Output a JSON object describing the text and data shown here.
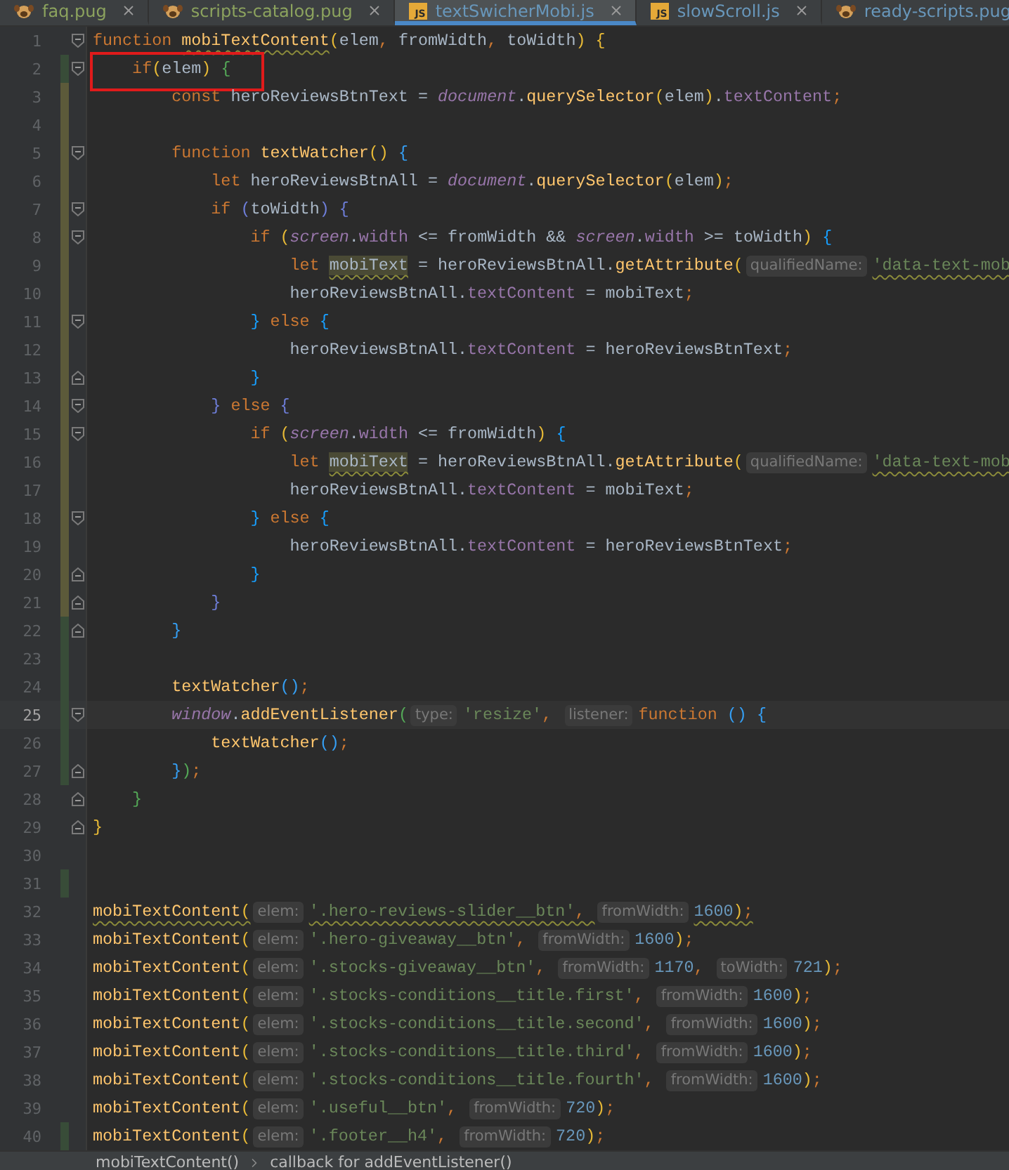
{
  "tabs": [
    {
      "label": "faq.pug",
      "kind": "pug",
      "color": "#8ca35e",
      "selected": false
    },
    {
      "label": "scripts-catalog.pug",
      "kind": "pug",
      "color": "#8ca35e",
      "selected": false
    },
    {
      "label": "textSwicherMobi.js",
      "kind": "js",
      "badge": "JS",
      "color": "#6897bb",
      "selected": true
    },
    {
      "label": "slowScroll.js",
      "kind": "js",
      "badge": "JS",
      "color": "#6897bb",
      "selected": false
    },
    {
      "label": "ready-scripts.pug",
      "kind": "pug",
      "color": "#6897bb",
      "selected": false
    }
  ],
  "lines": [
    {
      "number": "1",
      "kind": "fold-start",
      "current": false,
      "annotated": false,
      "tokens": [
        {
          "kind": "kw",
          "t": "function "
        },
        {
          "kind": "fn-warn",
          "t": "mobiTextContent"
        },
        {
          "kind": "brace",
          "t": "(",
          "color": "#e8ba36"
        },
        {
          "kind": "id",
          "t": "elem"
        },
        {
          "kind": "punct",
          "t": ", "
        },
        {
          "kind": "id",
          "t": "fromWidth"
        },
        {
          "kind": "punct",
          "t": ", "
        },
        {
          "kind": "id",
          "t": "toWidth"
        },
        {
          "kind": "brace",
          "t": ") ",
          "color": "#e8ba36"
        },
        {
          "kind": "brace",
          "t": "{",
          "color": "#e8ba36"
        }
      ]
    },
    {
      "number": "2",
      "kind": "fold-start",
      "color": "#384c38",
      "current": false,
      "annotated": true,
      "tokens": [
        {
          "kind": "kw",
          "t": "    if"
        },
        {
          "kind": "brace",
          "t": "(",
          "color": "#e8ba36"
        },
        {
          "kind": "id",
          "t": "elem"
        },
        {
          "kind": "brace",
          "t": ") ",
          "color": "#e8ba36"
        },
        {
          "kind": "brace",
          "t": "{",
          "color": "#54a857"
        }
      ]
    },
    {
      "number": "3",
      "kind": "plain",
      "color": "#5c5a3a",
      "current": false,
      "annotated": false,
      "tokens": [
        {
          "kind": "kw",
          "t": "        const "
        },
        {
          "kind": "id",
          "t": "heroReviewsBtnText = "
        },
        {
          "kind": "glob",
          "t": "document"
        },
        {
          "kind": "id",
          "t": "."
        },
        {
          "kind": "fn",
          "t": "querySelector"
        },
        {
          "kind": "brace",
          "t": "(",
          "color": "#e8ba36"
        },
        {
          "kind": "id",
          "t": "elem"
        },
        {
          "kind": "brace",
          "t": ")",
          "color": "#e8ba36"
        },
        {
          "kind": "id",
          "t": "."
        },
        {
          "kind": "prop",
          "t": "textContent"
        },
        {
          "kind": "punct",
          "t": ";"
        }
      ]
    },
    {
      "number": "4",
      "kind": "plain",
      "color": "#5c5a3a",
      "current": false,
      "annotated": false
    },
    {
      "number": "5",
      "kind": "fold-start",
      "color": "#5c5a3a",
      "current": false,
      "annotated": false,
      "tokens": [
        {
          "kind": "kw",
          "t": "        function "
        },
        {
          "kind": "fn",
          "t": "textWatcher"
        },
        {
          "kind": "brace",
          "t": "() ",
          "color": "#e8ba36"
        },
        {
          "kind": "brace",
          "t": "{",
          "color": "#359ff4"
        }
      ]
    },
    {
      "number": "6",
      "kind": "plain",
      "color": "#5c5a3a",
      "current": false,
      "annotated": false,
      "tokens": [
        {
          "kind": "kw",
          "t": "            let "
        },
        {
          "kind": "id",
          "t": "heroReviewsBtnAll = "
        },
        {
          "kind": "glob",
          "t": "document"
        },
        {
          "kind": "id",
          "t": "."
        },
        {
          "kind": "fn",
          "t": "querySelector"
        },
        {
          "kind": "brace",
          "t": "(",
          "color": "#e8ba36"
        },
        {
          "kind": "id",
          "t": "elem"
        },
        {
          "kind": "brace",
          "t": ")",
          "color": "#e8ba36"
        },
        {
          "kind": "punct",
          "t": ";"
        }
      ]
    },
    {
      "number": "7",
      "kind": "fold-start",
      "color": "#5c5a3a",
      "current": false,
      "annotated": false,
      "tokens": [
        {
          "kind": "kw",
          "t": "            if "
        },
        {
          "kind": "brace",
          "t": "(",
          "color": "#6e7ed9"
        },
        {
          "kind": "id",
          "t": "toWidth"
        },
        {
          "kind": "brace",
          "t": ") ",
          "color": "#6e7ed9"
        },
        {
          "kind": "brace",
          "t": "{",
          "color": "#6e7ed9"
        }
      ]
    },
    {
      "number": "8",
      "kind": "fold-start",
      "color": "#5c5a3a",
      "current": false,
      "annotated": false,
      "tokens": [
        {
          "kind": "kw",
          "t": "                if "
        },
        {
          "kind": "brace",
          "t": "(",
          "color": "#e8ba36"
        },
        {
          "kind": "glob",
          "t": "screen"
        },
        {
          "kind": "id",
          "t": "."
        },
        {
          "kind": "prop",
          "t": "width"
        },
        {
          "kind": "id",
          "t": " <= fromWidth && "
        },
        {
          "kind": "glob",
          "t": "screen"
        },
        {
          "kind": "id",
          "t": "."
        },
        {
          "kind": "prop",
          "t": "width"
        },
        {
          "kind": "id",
          "t": " >= toWidth"
        },
        {
          "kind": "brace",
          "t": ") ",
          "color": "#e8ba36"
        },
        {
          "kind": "brace",
          "t": "{",
          "color": "#179fff"
        }
      ]
    },
    {
      "number": "9",
      "kind": "plain",
      "color": "#5c5a3a",
      "current": false,
      "annotated": false,
      "tokens": [
        {
          "kind": "kw",
          "t": "                    let "
        },
        {
          "kind": "usage",
          "t": "mobiText"
        },
        {
          "kind": "id",
          "t": " = heroReviewsBtnAll."
        },
        {
          "kind": "fn",
          "t": "getAttribute"
        },
        {
          "kind": "brace",
          "t": "(",
          "color": "#e8ba36"
        },
        {
          "kind": "hint",
          "t": "qualifiedName:"
        },
        {
          "kind": "str-warn",
          "t": "'data-text-mob"
        }
      ]
    },
    {
      "number": "10",
      "kind": "plain",
      "color": "#5c5a3a",
      "current": false,
      "annotated": false,
      "tokens": [
        {
          "kind": "id",
          "t": "                    heroReviewsBtnAll."
        },
        {
          "kind": "prop",
          "t": "textContent"
        },
        {
          "kind": "id",
          "t": " = mobiText"
        },
        {
          "kind": "punct",
          "t": ";"
        }
      ]
    },
    {
      "number": "11",
      "kind": "fold-start",
      "color": "#5c5a3a",
      "current": false,
      "annotated": false,
      "tokens": [
        {
          "kind": "brace",
          "t": "                }",
          "color": "#179fff"
        },
        {
          "kind": "kw",
          "t": " else "
        },
        {
          "kind": "brace",
          "t": "{",
          "color": "#179fff"
        }
      ]
    },
    {
      "number": "12",
      "kind": "plain",
      "color": "#5c5a3a",
      "current": false,
      "annotated": false,
      "tokens": [
        {
          "kind": "id",
          "t": "                    heroReviewsBtnAll."
        },
        {
          "kind": "prop",
          "t": "textContent"
        },
        {
          "kind": "id",
          "t": " = heroReviewsBtnText"
        },
        {
          "kind": "punct",
          "t": ";"
        }
      ]
    },
    {
      "number": "13",
      "kind": "fold-end",
      "color": "#5c5a3a",
      "current": false,
      "annotated": false,
      "tokens": [
        {
          "kind": "brace",
          "t": "                }",
          "color": "#179fff"
        }
      ]
    },
    {
      "number": "14",
      "kind": "fold-start",
      "color": "#5c5a3a",
      "current": false,
      "annotated": false,
      "tokens": [
        {
          "kind": "brace",
          "t": "            }",
          "color": "#6e7ed9"
        },
        {
          "kind": "kw",
          "t": " else "
        },
        {
          "kind": "brace",
          "t": "{",
          "color": "#6e7ed9"
        }
      ]
    },
    {
      "number": "15",
      "kind": "fold-start",
      "color": "#5c5a3a",
      "current": false,
      "annotated": false,
      "tokens": [
        {
          "kind": "kw",
          "t": "                if "
        },
        {
          "kind": "brace",
          "t": "(",
          "color": "#e8ba36"
        },
        {
          "kind": "glob",
          "t": "screen"
        },
        {
          "kind": "id",
          "t": "."
        },
        {
          "kind": "prop",
          "t": "width"
        },
        {
          "kind": "id",
          "t": " <= fromWidth"
        },
        {
          "kind": "brace",
          "t": ") ",
          "color": "#e8ba36"
        },
        {
          "kind": "brace",
          "t": "{",
          "color": "#179fff"
        }
      ]
    },
    {
      "number": "16",
      "kind": "plain",
      "color": "#5c5a3a",
      "current": false,
      "annotated": false,
      "tokens": [
        {
          "kind": "kw",
          "t": "                    let "
        },
        {
          "kind": "usage",
          "t": "mobiText"
        },
        {
          "kind": "id",
          "t": " = heroReviewsBtnAll."
        },
        {
          "kind": "fn",
          "t": "getAttribute"
        },
        {
          "kind": "brace",
          "t": "(",
          "color": "#e8ba36"
        },
        {
          "kind": "hint",
          "t": "qualifiedName:"
        },
        {
          "kind": "str-warn",
          "t": "'data-text-mob"
        }
      ]
    },
    {
      "number": "17",
      "kind": "plain",
      "color": "#5c5a3a",
      "current": false,
      "annotated": false,
      "tokens": [
        {
          "kind": "id",
          "t": "                    heroReviewsBtnAll."
        },
        {
          "kind": "prop",
          "t": "textContent"
        },
        {
          "kind": "id",
          "t": " = mobiText"
        },
        {
          "kind": "punct",
          "t": ";"
        }
      ]
    },
    {
      "number": "18",
      "kind": "fold-start",
      "color": "#5c5a3a",
      "current": false,
      "annotated": false,
      "tokens": [
        {
          "kind": "brace",
          "t": "                }",
          "color": "#179fff"
        },
        {
          "kind": "kw",
          "t": " else "
        },
        {
          "kind": "brace",
          "t": "{",
          "color": "#179fff"
        }
      ]
    },
    {
      "number": "19",
      "kind": "plain",
      "color": "#5c5a3a",
      "current": false,
      "annotated": false,
      "tokens": [
        {
          "kind": "id",
          "t": "                    heroReviewsBtnAll."
        },
        {
          "kind": "prop",
          "t": "textContent"
        },
        {
          "kind": "id",
          "t": " = heroReviewsBtnText"
        },
        {
          "kind": "punct",
          "t": ";"
        }
      ]
    },
    {
      "number": "20",
      "kind": "fold-end",
      "color": "#5c5a3a",
      "current": false,
      "annotated": false,
      "tokens": [
        {
          "kind": "brace",
          "t": "                }",
          "color": "#179fff"
        }
      ]
    },
    {
      "number": "21",
      "kind": "fold-end",
      "color": "#5c5a3a",
      "current": false,
      "annotated": false,
      "tokens": [
        {
          "kind": "brace",
          "t": "            }",
          "color": "#6e7ed9"
        }
      ]
    },
    {
      "number": "22",
      "kind": "fold-end",
      "color": "#384c38",
      "current": false,
      "annotated": false,
      "tokens": [
        {
          "kind": "brace",
          "t": "        }",
          "color": "#359ff4"
        }
      ]
    },
    {
      "number": "23",
      "kind": "plain",
      "color": "#384c38",
      "current": false,
      "annotated": false
    },
    {
      "number": "24",
      "kind": "plain",
      "color": "#384c38",
      "current": false,
      "annotated": false,
      "tokens": [
        {
          "kind": "fn",
          "t": "        textWatcher"
        },
        {
          "kind": "brace",
          "t": "()",
          "color": "#359ff4"
        },
        {
          "kind": "punct",
          "t": ";"
        }
      ]
    },
    {
      "number": "25",
      "kind": "fold-start",
      "color": "#384c38",
      "current": true,
      "annotated": false,
      "tokens": [
        {
          "kind": "glob",
          "t": "        window"
        },
        {
          "kind": "id",
          "t": "."
        },
        {
          "kind": "fn",
          "t": "addEventListener"
        },
        {
          "kind": "brace",
          "t": "(",
          "color": "#54a857"
        },
        {
          "kind": "hint",
          "t": "type:"
        },
        {
          "kind": "str",
          "t": "'resize'"
        },
        {
          "kind": "punct",
          "t": ", "
        },
        {
          "kind": "hint",
          "t": "listener:"
        },
        {
          "kind": "kw",
          "t": "function "
        },
        {
          "kind": "brace",
          "t": "() ",
          "color": "#359ff4"
        },
        {
          "kind": "brace",
          "t": "{",
          "color": "#359ff4"
        }
      ]
    },
    {
      "number": "26",
      "kind": "plain",
      "color": "#384c38",
      "current": false,
      "annotated": false,
      "tokens": [
        {
          "kind": "fn",
          "t": "            textWatcher"
        },
        {
          "kind": "brace",
          "t": "()",
          "color": "#359ff4"
        },
        {
          "kind": "punct",
          "t": ";"
        }
      ]
    },
    {
      "number": "27",
      "kind": "fold-end",
      "color": "#384c38",
      "current": false,
      "annotated": false,
      "tokens": [
        {
          "kind": "brace",
          "t": "        }",
          "color": "#359ff4"
        },
        {
          "kind": "brace",
          "t": ")",
          "color": "#54a857"
        },
        {
          "kind": "punct",
          "t": ";"
        }
      ]
    },
    {
      "number": "28",
      "kind": "fold-end",
      "current": false,
      "annotated": false,
      "tokens": [
        {
          "kind": "brace",
          "t": "    }",
          "color": "#54a857"
        }
      ]
    },
    {
      "number": "29",
      "kind": "fold-end",
      "current": false,
      "annotated": false,
      "tokens": [
        {
          "kind": "brace",
          "t": "}",
          "color": "#e8ba36"
        }
      ]
    },
    {
      "number": "30",
      "kind": "plain",
      "current": false,
      "annotated": false
    },
    {
      "number": "31",
      "kind": "plain",
      "color": "#384c38",
      "current": false,
      "annotated": false
    },
    {
      "number": "32",
      "kind": "plain",
      "current": false,
      "annotated": false,
      "tokens": [
        {
          "kind": "fn-warn",
          "t": "mobiTextContent"
        },
        {
          "kind": "brace-warn",
          "t": "(",
          "color": "#e8ba36"
        },
        {
          "kind": "hint",
          "t": "elem:"
        },
        {
          "kind": "str-warn",
          "t": "'.hero-reviews-slider__btn'"
        },
        {
          "kind": "punct-warn",
          "t": ", "
        },
        {
          "kind": "hint",
          "t": "fromWidth:"
        },
        {
          "kind": "num-warn",
          "t": "1600"
        },
        {
          "kind": "brace-warn",
          "t": ")",
          "color": "#e8ba36"
        },
        {
          "kind": "punct-warn",
          "t": ";"
        }
      ]
    },
    {
      "number": "33",
      "kind": "plain",
      "current": false,
      "annotated": false,
      "tokens": [
        {
          "kind": "fn",
          "t": "mobiTextContent"
        },
        {
          "kind": "brace",
          "t": "(",
          "color": "#e8ba36"
        },
        {
          "kind": "hint",
          "t": "elem:"
        },
        {
          "kind": "str",
          "t": "'.hero-giveaway__btn'"
        },
        {
          "kind": "punct",
          "t": ", "
        },
        {
          "kind": "hint",
          "t": "fromWidth:"
        },
        {
          "kind": "num",
          "t": "1600"
        },
        {
          "kind": "brace",
          "t": ")",
          "color": "#e8ba36"
        },
        {
          "kind": "punct",
          "t": ";"
        }
      ]
    },
    {
      "number": "34",
      "kind": "plain",
      "current": false,
      "annotated": false,
      "tokens": [
        {
          "kind": "fn",
          "t": "mobiTextContent"
        },
        {
          "kind": "brace",
          "t": "(",
          "color": "#e8ba36"
        },
        {
          "kind": "hint",
          "t": "elem:"
        },
        {
          "kind": "str",
          "t": "'.stocks-giveaway__btn'"
        },
        {
          "kind": "punct",
          "t": ", "
        },
        {
          "kind": "hint",
          "t": "fromWidth:"
        },
        {
          "kind": "num",
          "t": "1170"
        },
        {
          "kind": "punct",
          "t": ", "
        },
        {
          "kind": "hint",
          "t": "toWidth:"
        },
        {
          "kind": "num",
          "t": "721"
        },
        {
          "kind": "brace",
          "t": ")",
          "color": "#e8ba36"
        },
        {
          "kind": "punct",
          "t": ";"
        }
      ]
    },
    {
      "number": "35",
      "kind": "plain",
      "current": false,
      "annotated": false,
      "tokens": [
        {
          "kind": "fn",
          "t": "mobiTextContent"
        },
        {
          "kind": "brace",
          "t": "(",
          "color": "#e8ba36"
        },
        {
          "kind": "hint",
          "t": "elem:"
        },
        {
          "kind": "str",
          "t": "'.stocks-conditions__title.first'"
        },
        {
          "kind": "punct",
          "t": ", "
        },
        {
          "kind": "hint",
          "t": "fromWidth:"
        },
        {
          "kind": "num",
          "t": "1600"
        },
        {
          "kind": "brace",
          "t": ")",
          "color": "#e8ba36"
        },
        {
          "kind": "punct",
          "t": ";"
        }
      ]
    },
    {
      "number": "36",
      "kind": "plain",
      "current": false,
      "annotated": false,
      "tokens": [
        {
          "kind": "fn",
          "t": "mobiTextContent"
        },
        {
          "kind": "brace",
          "t": "(",
          "color": "#e8ba36"
        },
        {
          "kind": "hint",
          "t": "elem:"
        },
        {
          "kind": "str",
          "t": "'.stocks-conditions__title.second'"
        },
        {
          "kind": "punct",
          "t": ", "
        },
        {
          "kind": "hint",
          "t": "fromWidth:"
        },
        {
          "kind": "num",
          "t": "1600"
        },
        {
          "kind": "brace",
          "t": ")",
          "color": "#e8ba36"
        },
        {
          "kind": "punct",
          "t": ";"
        }
      ]
    },
    {
      "number": "37",
      "kind": "plain",
      "current": false,
      "annotated": false,
      "tokens": [
        {
          "kind": "fn",
          "t": "mobiTextContent"
        },
        {
          "kind": "brace",
          "t": "(",
          "color": "#e8ba36"
        },
        {
          "kind": "hint",
          "t": "elem:"
        },
        {
          "kind": "str",
          "t": "'.stocks-conditions__title.third'"
        },
        {
          "kind": "punct",
          "t": ", "
        },
        {
          "kind": "hint",
          "t": "fromWidth:"
        },
        {
          "kind": "num",
          "t": "1600"
        },
        {
          "kind": "brace",
          "t": ")",
          "color": "#e8ba36"
        },
        {
          "kind": "punct",
          "t": ";"
        }
      ]
    },
    {
      "number": "38",
      "kind": "plain",
      "current": false,
      "annotated": false,
      "tokens": [
        {
          "kind": "fn",
          "t": "mobiTextContent"
        },
        {
          "kind": "brace",
          "t": "(",
          "color": "#e8ba36"
        },
        {
          "kind": "hint",
          "t": "elem:"
        },
        {
          "kind": "str",
          "t": "'.stocks-conditions__title.fourth'"
        },
        {
          "kind": "punct",
          "t": ", "
        },
        {
          "kind": "hint",
          "t": "fromWidth:"
        },
        {
          "kind": "num",
          "t": "1600"
        },
        {
          "kind": "brace",
          "t": ")",
          "color": "#e8ba36"
        },
        {
          "kind": "punct",
          "t": ";"
        }
      ]
    },
    {
      "number": "39",
      "kind": "plain",
      "current": false,
      "annotated": false,
      "tokens": [
        {
          "kind": "fn",
          "t": "mobiTextContent"
        },
        {
          "kind": "brace",
          "t": "(",
          "color": "#e8ba36"
        },
        {
          "kind": "hint",
          "t": "elem:"
        },
        {
          "kind": "str",
          "t": "'.useful__btn'"
        },
        {
          "kind": "punct",
          "t": ", "
        },
        {
          "kind": "hint",
          "t": "fromWidth:"
        },
        {
          "kind": "num",
          "t": "720"
        },
        {
          "kind": "brace",
          "t": ")",
          "color": "#e8ba36"
        },
        {
          "kind": "punct",
          "t": ";"
        }
      ]
    },
    {
      "number": "40",
      "kind": "plain",
      "color": "#384c38",
      "current": false,
      "annotated": false,
      "tokens": [
        {
          "kind": "fn",
          "t": "mobiTextContent"
        },
        {
          "kind": "brace",
          "t": "(",
          "color": "#e8ba36"
        },
        {
          "kind": "hint",
          "t": "elem:"
        },
        {
          "kind": "str",
          "t": "'.footer__h4'"
        },
        {
          "kind": "punct",
          "t": ", "
        },
        {
          "kind": "hint",
          "t": "fromWidth:"
        },
        {
          "kind": "num",
          "t": "720"
        },
        {
          "kind": "brace",
          "t": ")",
          "color": "#e8ba36"
        },
        {
          "kind": "punct",
          "t": ";"
        }
      ]
    }
  ],
  "breadcrumbs": [
    "mobiTextContent()",
    "callback for addEventListener()"
  ]
}
